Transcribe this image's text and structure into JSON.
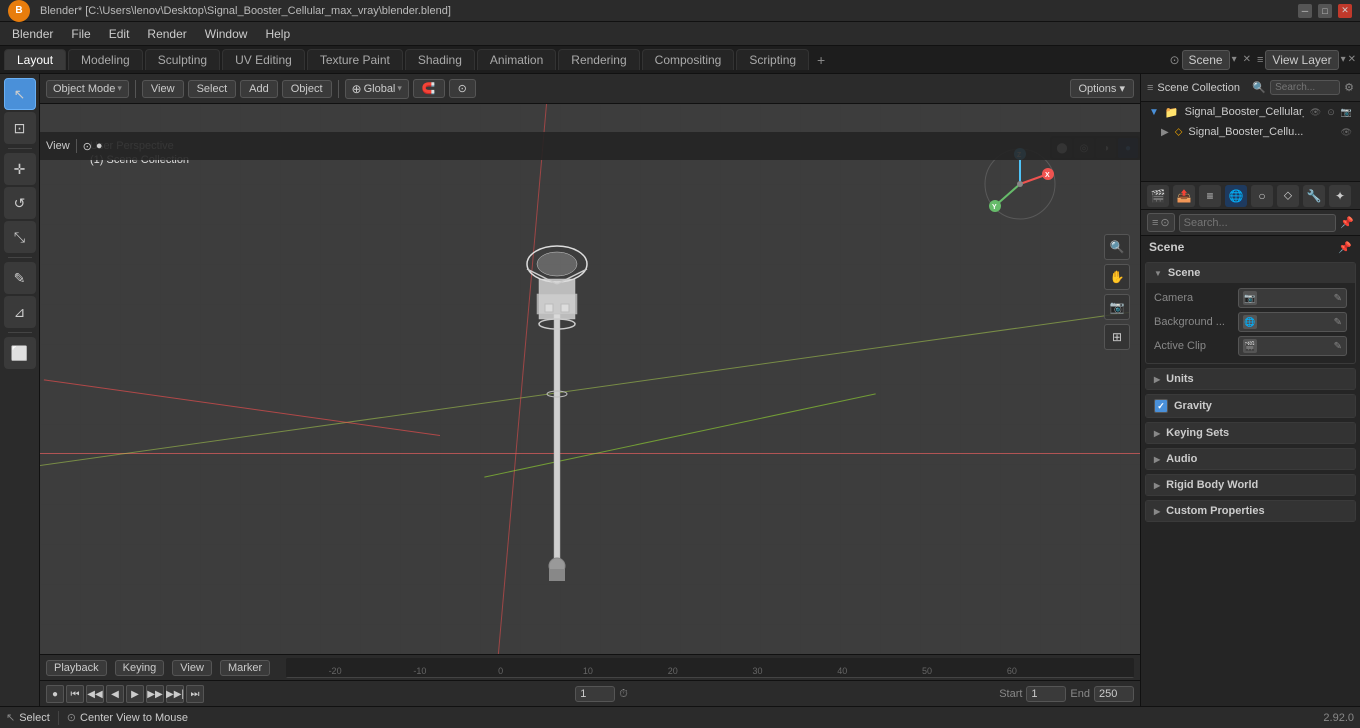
{
  "titlebar": {
    "title": "Blender* [C:\\Users\\lenov\\Desktop\\Signal_Booster_Cellular_max_vray\\blender.blend]",
    "controls": [
      "minimize",
      "maximize",
      "close"
    ]
  },
  "menubar": {
    "logo": "B",
    "items": [
      "Blender",
      "File",
      "Edit",
      "Render",
      "Window",
      "Help"
    ]
  },
  "workspacetabs": {
    "tabs": [
      "Layout",
      "Modeling",
      "Sculpting",
      "UV Editing",
      "Texture Paint",
      "Shading",
      "Animation",
      "Rendering",
      "Compositing",
      "Scripting"
    ],
    "active": "Layout",
    "scene_label": "Scene",
    "viewlayer_label": "View Layer",
    "add_icon": "+"
  },
  "action_toolbar": {
    "mode": "Object Mode",
    "view_label": "View",
    "select_label": "Select",
    "add_label": "Add",
    "object_label": "Object",
    "transform": "Global",
    "snap_icon": "magnet",
    "proportional_icon": "circle"
  },
  "viewport": {
    "info_line1": "User Perspective",
    "info_line2": "(1) Scene Collection",
    "gizmo": {
      "z_label": "Z",
      "x_label": "X",
      "y_label": "Y"
    }
  },
  "left_toolbar": {
    "tools": [
      {
        "icon": "↖",
        "name": "select",
        "active": true
      },
      {
        "icon": "⊡",
        "name": "select-box",
        "active": false
      },
      {
        "icon": "↔",
        "name": "move",
        "active": false
      },
      {
        "icon": "↺",
        "name": "rotate",
        "active": false
      },
      {
        "icon": "⊞",
        "name": "scale",
        "active": false
      },
      {
        "icon": "✎",
        "name": "annotate",
        "active": false
      },
      {
        "icon": "⊿",
        "name": "measure",
        "active": false
      },
      {
        "icon": "⬜",
        "name": "primitive",
        "active": false
      }
    ]
  },
  "right_gizmos": [
    "🔍+",
    "✋",
    "📷",
    "⊞"
  ],
  "timeline": {
    "header_items": [
      "Playback",
      "Keying",
      "View",
      "Marker"
    ],
    "frame_current": "1",
    "frame_start_label": "Start",
    "frame_start": "1",
    "frame_end_label": "End",
    "frame_end": "250",
    "controls": [
      "skip-back",
      "prev-keyframe",
      "prev-frame",
      "play",
      "next-frame",
      "next-keyframe",
      "skip-forward"
    ]
  },
  "outliner": {
    "title": "Scene Collection",
    "items": [
      {
        "label": "Signal_Booster_Cellular_",
        "level": 1,
        "icon": "📁",
        "expanded": true
      },
      {
        "label": "Signal_Booster_Cellu...",
        "level": 2,
        "icon": "🔶"
      }
    ]
  },
  "properties": {
    "active_tab": "scene",
    "tabs": [
      "render",
      "output",
      "view-layer",
      "scene",
      "world",
      "object",
      "particles",
      "physics",
      "constraints",
      "data",
      "material",
      "shading"
    ],
    "title": "Scene",
    "sections": [
      {
        "label": "Scene",
        "expanded": true,
        "rows": [
          {
            "label": "Camera",
            "value": "",
            "icon": "📷"
          },
          {
            "label": "Background ...",
            "value": "",
            "icon": "🌐"
          },
          {
            "label": "Active Clip",
            "value": "",
            "icon": "🎬"
          }
        ]
      },
      {
        "label": "Units",
        "expanded": false
      },
      {
        "label": "Gravity",
        "expanded": false,
        "checked": true
      },
      {
        "label": "Keying Sets",
        "expanded": false
      },
      {
        "label": "Audio",
        "expanded": false
      },
      {
        "label": "Rigid Body World",
        "expanded": false
      },
      {
        "label": "Custom Properties",
        "expanded": false
      }
    ]
  },
  "bottom_bar": {
    "items": [
      "Select",
      "Center View to Mouse"
    ],
    "version": "2.92.0"
  },
  "icons": {
    "search": "🔍",
    "gear": "⚙",
    "scene": "🎬",
    "camera": "📷",
    "world": "🌐",
    "object": "🔶",
    "particles": "✦",
    "check": "✓",
    "arrow_right": "▶",
    "arrow_down": "▼",
    "pin": "📌"
  }
}
